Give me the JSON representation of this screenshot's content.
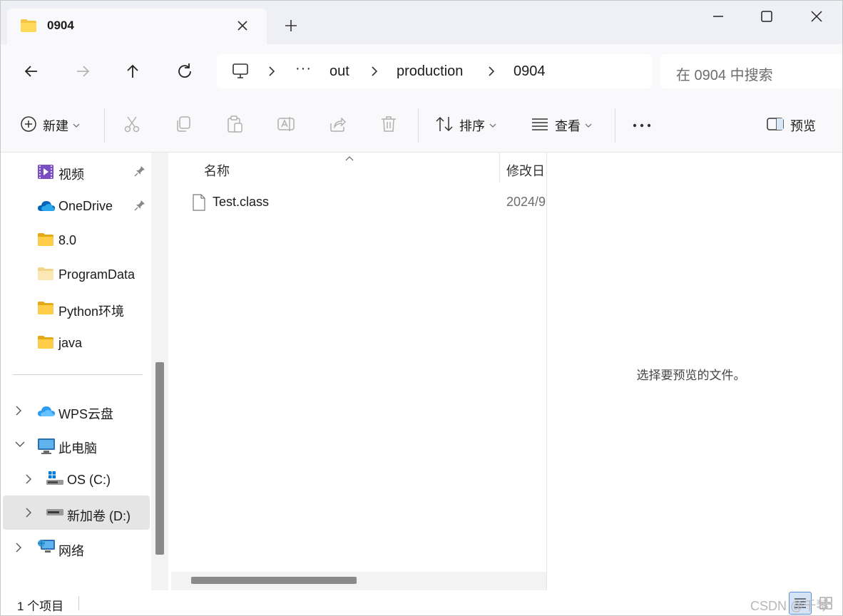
{
  "tab": {
    "title": "0904",
    "close_icon": "close-icon",
    "folder_icon": "folder-icon"
  },
  "window_controls": [
    "minimize-icon",
    "maximize-icon",
    "close-icon"
  ],
  "nav_buttons": [
    "back-icon",
    "forward-icon",
    "up-icon",
    "refresh-icon"
  ],
  "address": {
    "crumbs": [
      "out",
      "production",
      "0904"
    ],
    "overflow": "···"
  },
  "search": {
    "placeholder": "在 0904 中搜索"
  },
  "command_bar": {
    "new_label": "新建",
    "sort_label": "排序",
    "view_label": "查看",
    "more_label": "···",
    "preview_label": "预览",
    "disabled_actions": [
      "cut-icon",
      "copy-icon",
      "paste-icon",
      "rename-icon",
      "share-icon",
      "delete-icon"
    ]
  },
  "sidebar": {
    "items": [
      {
        "label": "视频",
        "icon": "video-icon",
        "pinned": true
      },
      {
        "label": "OneDrive",
        "icon": "onedrive-icon",
        "pinned": true
      },
      {
        "label": "8.0",
        "icon": "folder-icon"
      },
      {
        "label": "ProgramData",
        "icon": "folder-icon"
      },
      {
        "label": "Python环境",
        "icon": "folder-icon"
      },
      {
        "label": "java",
        "icon": "folder-icon"
      },
      {
        "label": "WPS云盘",
        "icon": "cloud-icon",
        "expanded": false
      },
      {
        "label": "此电脑",
        "icon": "computer-icon",
        "expanded": true
      },
      {
        "label": "OS (C:)",
        "icon": "windows-drive-icon",
        "expanded": false
      },
      {
        "label": "新加卷 (D:)",
        "icon": "drive-icon",
        "expanded": false,
        "selected": true
      },
      {
        "label": "网络",
        "icon": "network-icon",
        "expanded": false
      }
    ]
  },
  "file_list": {
    "columns": [
      "名称",
      "修改日"
    ],
    "rows": [
      {
        "name": "Test.class",
        "modified": "2024/9",
        "icon": "file-icon"
      }
    ]
  },
  "preview": {
    "message": "选择要预览的文件。"
  },
  "status": {
    "count": "1 个项目"
  },
  "watermark": "CSDN @千琴",
  "colors": {
    "folder": "#f4c542",
    "accent": "#0067c0",
    "selected_bg": "#e5e5e5"
  }
}
